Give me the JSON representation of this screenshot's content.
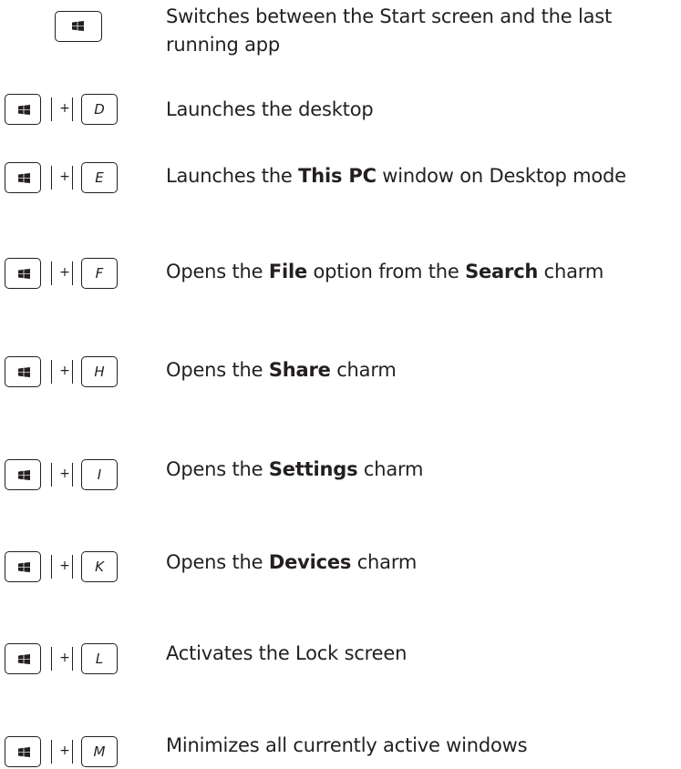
{
  "shortcuts": [
    {
      "keys": [
        "win"
      ],
      "letter": "",
      "parts": [
        {
          "text": "Switches between the Start screen and the last running app",
          "bold": false
        }
      ]
    },
    {
      "keys": [
        "win",
        "D"
      ],
      "letter": "D",
      "parts": [
        {
          "text": "Launches the desktop",
          "bold": false
        }
      ]
    },
    {
      "keys": [
        "win",
        "E"
      ],
      "letter": "E",
      "parts": [
        {
          "text": "Launches the ",
          "bold": false
        },
        {
          "text": "This PC",
          "bold": true
        },
        {
          "text": " window on Desktop mode",
          "bold": false
        }
      ]
    },
    {
      "keys": [
        "win",
        "F"
      ],
      "letter": "F",
      "parts": [
        {
          "text": "Opens the ",
          "bold": false
        },
        {
          "text": "File",
          "bold": true
        },
        {
          "text": " option from the ",
          "bold": false
        },
        {
          "text": "Search",
          "bold": true
        },
        {
          "text": " charm",
          "bold": false
        }
      ]
    },
    {
      "keys": [
        "win",
        "H"
      ],
      "letter": "H",
      "parts": [
        {
          "text": "Opens the ",
          "bold": false
        },
        {
          "text": "Share",
          "bold": true
        },
        {
          "text": " charm",
          "bold": false
        }
      ]
    },
    {
      "keys": [
        "win",
        "I"
      ],
      "letter": "I",
      "parts": [
        {
          "text": "Opens the ",
          "bold": false
        },
        {
          "text": "Settings",
          "bold": true
        },
        {
          "text": " charm",
          "bold": false
        }
      ]
    },
    {
      "keys": [
        "win",
        "K"
      ],
      "letter": "K",
      "parts": [
        {
          "text": "Opens the ",
          "bold": false
        },
        {
          "text": "Devices",
          "bold": true
        },
        {
          "text": " charm",
          "bold": false
        }
      ]
    },
    {
      "keys": [
        "win",
        "L"
      ],
      "letter": "L",
      "parts": [
        {
          "text": "Activates the Lock screen",
          "bold": false
        }
      ]
    },
    {
      "keys": [
        "win",
        "M"
      ],
      "letter": "M",
      "parts": [
        {
          "text": "Minimizes all currently active windows",
          "bold": false
        }
      ]
    }
  ],
  "icons": {
    "windows_key": "windows-logo-icon",
    "plus": "+"
  },
  "colors": {
    "text": "#231f20",
    "background": "#ffffff"
  }
}
